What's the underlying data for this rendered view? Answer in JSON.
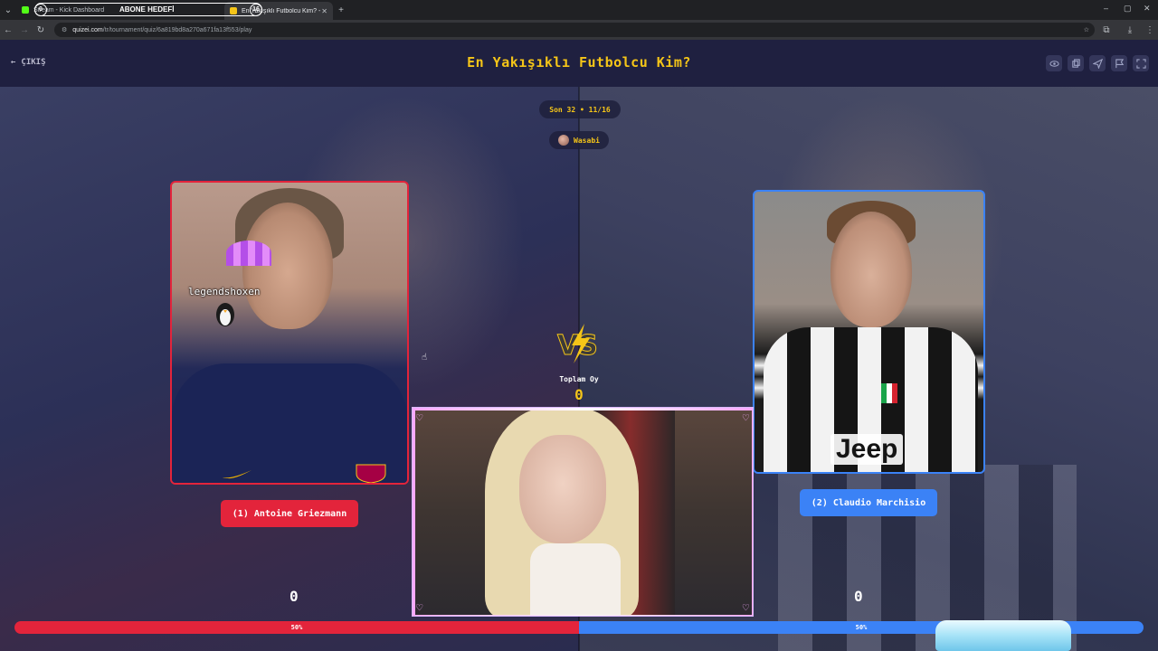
{
  "browser": {
    "tabs": [
      {
        "title": "Stream - Kick Dashboard",
        "active": false
      },
      {
        "title": "",
        "active": false
      },
      {
        "title": "En Yakışıklı Futbolcu Kim? - Tie",
        "active": true
      }
    ],
    "overlay": {
      "label": "ABONE HEDEFİ",
      "current": "0",
      "goal": "16"
    },
    "new_tab": "+",
    "url_host": "quizei.com",
    "url_path": "/tr/tournament/quiz/6a819bd8a270a671fa13f553/play",
    "window_controls": [
      "–",
      "▢",
      "✕"
    ]
  },
  "header": {
    "exit_label": "ÇIKIŞ",
    "title": "En Yakışıklı Futbolcu Kim?",
    "icons": [
      "eye-icon",
      "copy-icon",
      "send-icon",
      "flag-icon",
      "fullscreen-icon"
    ]
  },
  "round": {
    "label": "Son 32 • 11/16"
  },
  "user": {
    "name": "Wasabi"
  },
  "left": {
    "name": "(1) Antoine Griezmann",
    "score": "0",
    "percent_label": "50%",
    "percent": 50,
    "color": "#e3243b",
    "chat_user": "legendshoxen"
  },
  "right": {
    "name": "(2) Claudio Marchisio",
    "score": "0",
    "percent_label": "50%",
    "percent": 50,
    "color": "#3b82f6",
    "sponsor": "Jeep"
  },
  "vs": {
    "total_label": "Toplam Oy",
    "total_value": "0"
  },
  "colors": {
    "accent": "#f5c518",
    "background": "#242443"
  }
}
